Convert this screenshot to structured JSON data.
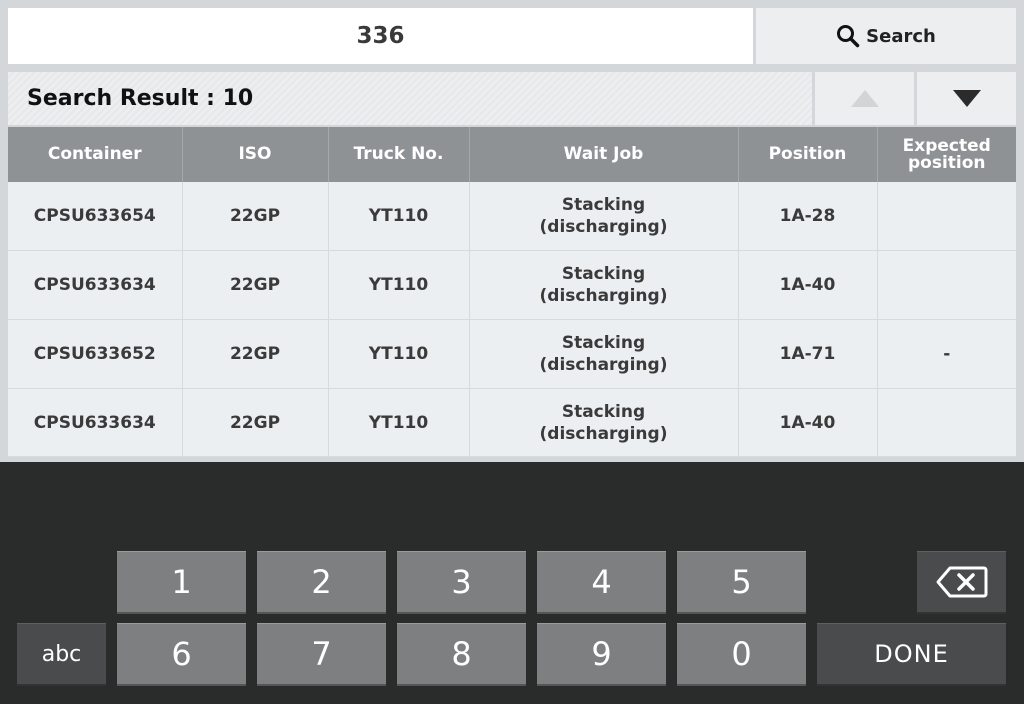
{
  "search": {
    "value": "336",
    "button_label": "Search"
  },
  "result": {
    "label": "Search Result : 10"
  },
  "table": {
    "headers": [
      "Container",
      "ISO",
      "Truck No.",
      "Wait Job",
      "Position",
      "Expected position"
    ],
    "rows": [
      {
        "container": "CPSU633654",
        "iso": "22GP",
        "truck": "YT110",
        "wait_job": "Stacking",
        "wait_job_sub": "(discharging)",
        "position": "1A-28",
        "expected": ""
      },
      {
        "container": "CPSU633634",
        "iso": "22GP",
        "truck": "YT110",
        "wait_job": "Stacking",
        "wait_job_sub": "(discharging)",
        "position": "1A-40",
        "expected": ""
      },
      {
        "container": "CPSU633652",
        "iso": "22GP",
        "truck": "YT110",
        "wait_job": "Stacking",
        "wait_job_sub": "(discharging)",
        "position": "1A-71",
        "expected": "-"
      },
      {
        "container": "CPSU633634",
        "iso": "22GP",
        "truck": "YT110",
        "wait_job": "Stacking",
        "wait_job_sub": "(discharging)",
        "position": "1A-40",
        "expected": ""
      }
    ]
  },
  "keyboard": {
    "row1": [
      "1",
      "2",
      "3",
      "4",
      "5"
    ],
    "row2": [
      "6",
      "7",
      "8",
      "9",
      "0"
    ],
    "abc_label": "abc",
    "done_label": "DONE"
  },
  "icons": {
    "search": "search-icon",
    "scroll_up": "triangle-up-icon",
    "scroll_down": "triangle-down-icon",
    "backspace": "backspace-icon"
  },
  "colors": {
    "header_bg": "#8f9294",
    "keyboard_bg": "#2a2b2b",
    "key_bg": "#7e7f80",
    "key_dark_bg": "#4a4b4c"
  }
}
